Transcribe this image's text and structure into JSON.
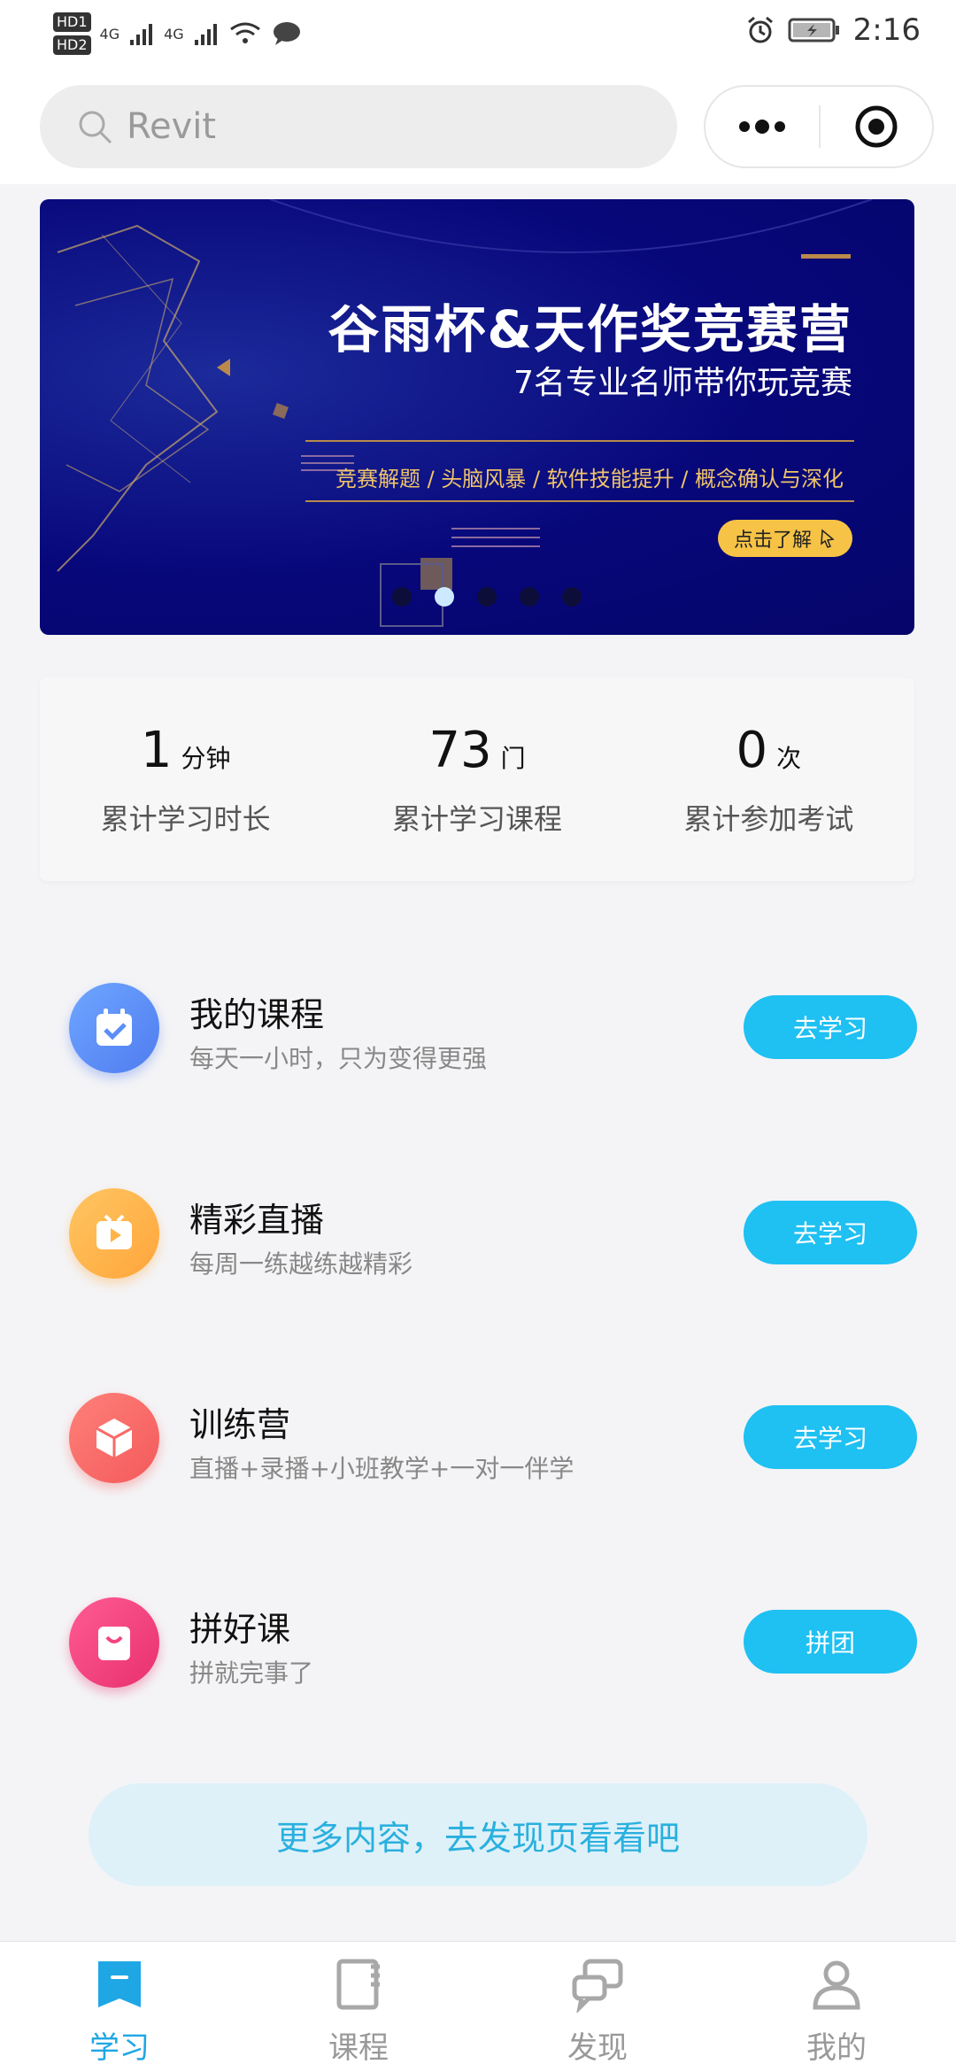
{
  "status_bar": {
    "left_tags": [
      "HD1",
      "HD2"
    ],
    "network_1": "4G",
    "network_2": "4G",
    "time": "2:16"
  },
  "search": {
    "placeholder": "Revit"
  },
  "banner": {
    "title": "谷雨杯&天作奖竞赛营",
    "subtitle": "7名专业名师带你玩竞赛",
    "tags": "竞赛解题 / 头脑风暴 / 软件技能提升 / 概念确认与深化",
    "cta": "点击了解",
    "slides_count": 5,
    "active_slide_index": 1
  },
  "stats": [
    {
      "value": "1",
      "unit": "分钟",
      "label": "累计学习时长"
    },
    {
      "value": "73",
      "unit": "门",
      "label": "累计学习课程"
    },
    {
      "value": "0",
      "unit": "次",
      "label": "累计参加考试"
    }
  ],
  "features": [
    {
      "title": "我的课程",
      "subtitle": "每天一小时，只为变得更强",
      "button": "去学习",
      "icon": "calendar-check-icon",
      "color": "#5b8ef8"
    },
    {
      "title": "精彩直播",
      "subtitle": "每周一练越练越精彩",
      "button": "去学习",
      "icon": "tv-play-icon",
      "color": "#ffb447"
    },
    {
      "title": "训练营",
      "subtitle": "直播+录播+小班教学+一对一伴学",
      "button": "去学习",
      "icon": "cube-icon",
      "color": "#f96a68"
    },
    {
      "title": "拼好课",
      "subtitle": "拼就完事了",
      "button": "拼团",
      "icon": "shopping-bag-icon",
      "color": "#f2447f"
    }
  ],
  "more_content": "更多内容，去发现页看看吧",
  "tabs": [
    {
      "label": "学习",
      "icon": "bookmark-icon",
      "active": true
    },
    {
      "label": "课程",
      "icon": "book-icon",
      "active": false
    },
    {
      "label": "发现",
      "icon": "discover-icon",
      "active": false
    },
    {
      "label": "我的",
      "icon": "user-icon",
      "active": false
    }
  ],
  "colors": {
    "accent": "#1fc0f2",
    "tab_active": "#1fa7e5",
    "banner_bg": "#07077a"
  }
}
